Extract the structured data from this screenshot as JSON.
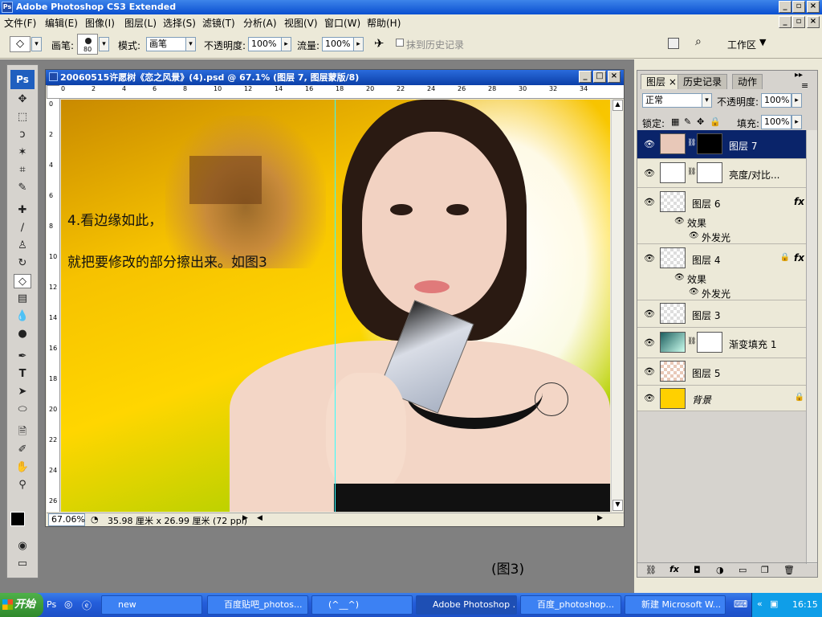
{
  "window": {
    "title": "Adobe Photoshop CS3 Extended",
    "app_icon": "Ps"
  },
  "menu": [
    "文件(F)",
    "编辑(E)",
    "图像(I)",
    "图层(L)",
    "选择(S)",
    "滤镜(T)",
    "分析(A)",
    "视图(V)",
    "窗口(W)",
    "帮助(H)"
  ],
  "options": {
    "brush_label": "画笔:",
    "brush_size": "80",
    "mode_label": "模式:",
    "mode_value": "画笔",
    "opacity_label": "不透明度:",
    "opacity_value": "100%",
    "flow_label": "流量:",
    "flow_value": "100%",
    "history_label": "抹到历史记录",
    "workspace_label": "工作区"
  },
  "toolbox": {
    "logo": "Ps"
  },
  "document": {
    "title": "20060515许愿树《恋之风景》(4).psd @ 67.1% (图层 7, 图层蒙版/8)",
    "ruler_top": [
      "0",
      "2",
      "4",
      "6",
      "8",
      "10",
      "12",
      "14",
      "16",
      "18",
      "20",
      "22",
      "24",
      "26",
      "28",
      "30",
      "32",
      "34"
    ],
    "ruler_left": [
      "0",
      "2",
      "4",
      "6",
      "8",
      "10",
      "12",
      "14",
      "16",
      "18",
      "20",
      "22",
      "24",
      "26"
    ],
    "canvas_text_1": "4.看边缘如此，",
    "canvas_text_2": "就把要修改的部分擦出来。如图3",
    "zoom": "67.06%",
    "doc_size": "35.98 厘米 x 26.99 厘米 (72 ppi)"
  },
  "caption": "(图3)",
  "layers_panel": {
    "tabs": [
      "图层",
      "历史记录",
      "动作"
    ],
    "blend_mode": "正常",
    "opacity_label": "不透明度:",
    "opacity_value": "100%",
    "lock_label": "锁定:",
    "fill_label": "填充:",
    "fill_value": "100%",
    "layers": [
      {
        "name": "图层 7",
        "selected": true
      },
      {
        "name": "亮度/对比...",
        "selected": false
      },
      {
        "name": "图层 6",
        "fx": "fx",
        "effects_label": "效果",
        "effect": "外发光"
      },
      {
        "name": "图层 4",
        "fx": "fx",
        "effects_label": "效果",
        "effect": "外发光"
      },
      {
        "name": "图层 3"
      },
      {
        "name": "渐变填充 1"
      },
      {
        "name": "图层 5"
      },
      {
        "name": "背景"
      }
    ]
  },
  "taskbar": {
    "start": "开始",
    "tasks": [
      "new",
      "百度贴吧_photos...",
      "(^__^)",
      "Adobe Photoshop ...",
      "百度_photoshop...",
      "新建 Microsoft W..."
    ],
    "clock": "16:15"
  },
  "colors": {
    "accent": "#0a246a",
    "canvas_yellow": "#ffd600",
    "bg_layer_yellow": "#ffd000"
  }
}
